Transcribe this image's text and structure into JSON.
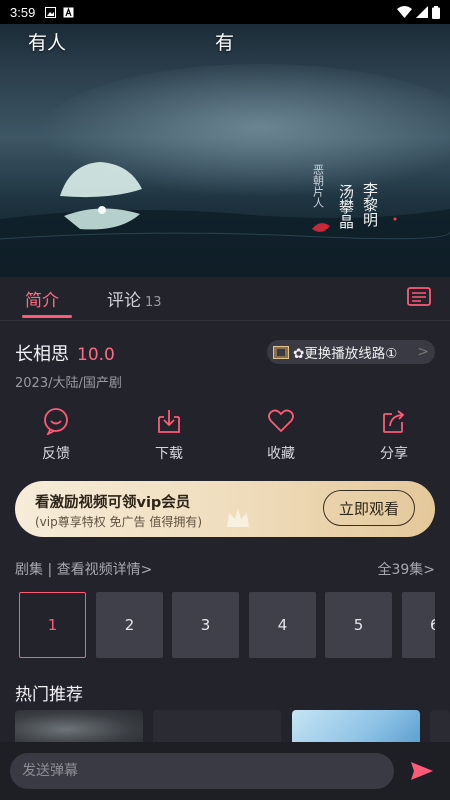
{
  "status_bar": {
    "time": "3:59"
  },
  "video": {
    "danmaku": [
      "有人",
      "有"
    ],
    "poster_text": {
      "actor_line": "李黎明",
      "actor_line2": "汤攀晶",
      "credit": "恶朝片人"
    }
  },
  "tabs": {
    "intro": "简介",
    "comments": "评论",
    "comments_count": "13"
  },
  "show": {
    "title": "长相思",
    "score": "10.0",
    "meta": "2023/大陆/国产剧",
    "switch_route": "✿更换播放线路①"
  },
  "actions": [
    {
      "label": "反馈",
      "icon": "feedback-icon"
    },
    {
      "label": "下载",
      "icon": "download-icon"
    },
    {
      "label": "收藏",
      "icon": "heart-icon"
    },
    {
      "label": "分享",
      "icon": "share-icon"
    }
  ],
  "vip_banner": {
    "title": "看激励视频可领vip会员",
    "subtitle": "(vip尊享特权 免广告 值得拥有)",
    "button": "立即观看"
  },
  "episodes_header": {
    "label": "剧集 | 查看视频详情>",
    "count": "全39集>"
  },
  "episodes": [
    "1",
    "2",
    "3",
    "4",
    "5",
    "6"
  ],
  "hot": {
    "title": "热门推荐"
  },
  "bottom_bar": {
    "placeholder": "发送弹幕"
  },
  "colors": {
    "accent": "#ff5a78",
    "background": "#23232b",
    "vip_gold": "#efdcbb"
  }
}
